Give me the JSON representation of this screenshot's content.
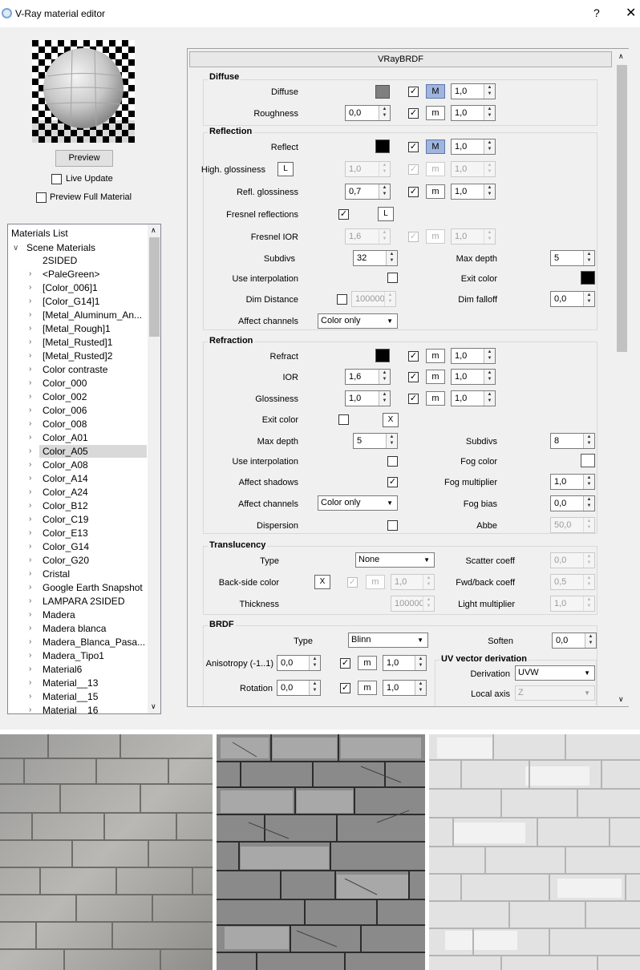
{
  "window": {
    "title": "V-Ray material editor",
    "help": "?",
    "close": "✕"
  },
  "preview": {
    "button": "Preview",
    "live_update": "Live Update",
    "preview_full": "Preview Full Material"
  },
  "materials": {
    "header": "Materials List",
    "root": "Scene Materials",
    "items": [
      "2SIDED",
      "<PaleGreen>",
      "[Color_006]1",
      "[Color_G14]1",
      "[Metal_Aluminum_An...",
      "[Metal_Rough]1",
      "[Metal_Rusted]1",
      "[Metal_Rusted]2",
      "Color contraste",
      "Color_000",
      "Color_002",
      "Color_006",
      "Color_008",
      "Color_A01",
      "Color_A05",
      "Color_A08",
      "Color_A14",
      "Color_A24",
      "Color_B12",
      "Color_C19",
      "Color_E13",
      "Color_G14",
      "Color_G20",
      "Cristal",
      "Google Earth Snapshot",
      "LAMPARA 2SIDED",
      "Madera",
      "Madera blanca",
      "Madera_Blanca_Pasa...",
      "Madera_Tipo1",
      "Material6",
      "Material__13",
      "Material__15",
      "Material__16"
    ],
    "selected": "Color_A05"
  },
  "panel": {
    "title": "VRayBRDF"
  },
  "diffuse": {
    "group": "Diffuse",
    "diffuse_label": "Diffuse",
    "diffuse_color": "#7f7f7f",
    "diffuse_m": "M",
    "diffuse_amount": "1,0",
    "roughness_label": "Roughness",
    "roughness": "0,0",
    "roughness_m": "m",
    "roughness_amount": "1,0"
  },
  "reflection": {
    "group": "Reflection",
    "reflect_label": "Reflect",
    "reflect_color": "#000000",
    "reflect_m": "M",
    "reflect_amount": "1,0",
    "hgloss_label": "High. glossiness",
    "hgloss_l": "L",
    "hgloss": "1,0",
    "hgloss_m": "m",
    "hgloss_amount": "1,0",
    "rgloss_label": "Refl. glossiness",
    "rgloss": "0,7",
    "rgloss_m": "m",
    "rgloss_amount": "1,0",
    "fresnel_label": "Fresnel reflections",
    "fresnel_l": "L",
    "fior_label": "Fresnel IOR",
    "fior": "1,6",
    "fior_m": "m",
    "fior_amount": "1,0",
    "subdivs_label": "Subdivs",
    "subdivs": "32",
    "maxdepth_label": "Max depth",
    "maxdepth": "5",
    "useinterp_label": "Use interpolation",
    "exitcolor_label": "Exit color",
    "exit_color": "#000000",
    "dimdist_label": "Dim Distance",
    "dimdist": "100000",
    "dimfalloff_label": "Dim falloff",
    "dimfalloff": "0,0",
    "affect_label": "Affect channels",
    "affect": "Color only"
  },
  "refraction": {
    "group": "Refraction",
    "refract_label": "Refract",
    "refract_color": "#000000",
    "refract_m": "m",
    "refract_amount": "1,0",
    "ior_label": "IOR",
    "ior": "1,6",
    "ior_m": "m",
    "ior_amount": "1,0",
    "gloss_label": "Glossiness",
    "gloss": "1,0",
    "gloss_m": "m",
    "gloss_amount": "1,0",
    "exitcolor_label": "Exit color",
    "exit_x": "X",
    "maxdepth_label": "Max depth",
    "maxdepth": "5",
    "subdivs_label": "Subdivs",
    "subdivs": "8",
    "useinterp_label": "Use interpolation",
    "fogcolor_label": "Fog color",
    "fog_color": "#ffffff",
    "affectshadows_label": "Affect shadows",
    "fogmult_label": "Fog multiplier",
    "fogmult": "1,0",
    "affect_label": "Affect channels",
    "affect": "Color only",
    "fogbias_label": "Fog bias",
    "fogbias": "0,0",
    "dispersion_label": "Dispersion",
    "abbe_label": "Abbe",
    "abbe": "50,0"
  },
  "translucency": {
    "group": "Translucency",
    "type_label": "Type",
    "type": "None",
    "scatter_label": "Scatter coeff",
    "scatter": "0,0",
    "backside_label": "Back-side color",
    "back_x": "X",
    "back_m": "m",
    "back_amount": "1,0",
    "fwdback_label": "Fwd/back coeff",
    "fwdback": "0,5",
    "thickness_label": "Thickness",
    "thickness": "100000",
    "lightmult_label": "Light multiplier",
    "lightmult": "1,0"
  },
  "brdf": {
    "group": "BRDF",
    "type_label": "Type",
    "type": "Blinn",
    "soften_label": "Soften",
    "soften": "0,0",
    "aniso_label": "Anisotropy (-1..1)",
    "aniso": "0,0",
    "aniso_m": "m",
    "aniso_amount": "1,0",
    "rotation_label": "Rotation",
    "rotation": "0,0",
    "rotation_m": "m",
    "rotation_amount": "1,0",
    "uv_group": "UV vector derivation",
    "derivation_label": "Derivation",
    "derivation": "UVW",
    "localaxis_label": "Local axis",
    "localaxis": "Z"
  }
}
